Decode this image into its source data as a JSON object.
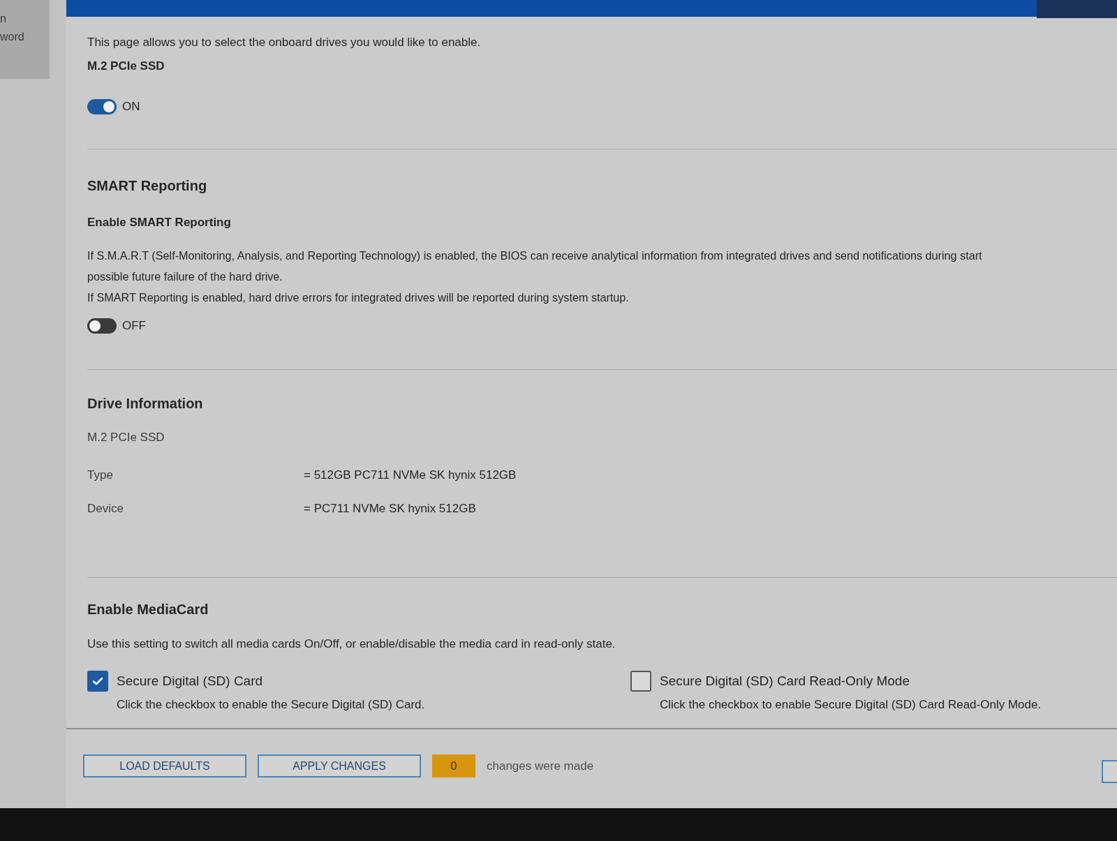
{
  "sidebar": {
    "items": [
      "n",
      "word"
    ]
  },
  "onboard_drives": {
    "description": "This page allows you to select the onboard drives you would like to enable.",
    "setting_label": "M.2 PCIe SSD",
    "on": true,
    "state_label": "ON"
  },
  "smart_reporting": {
    "title": "SMART Reporting",
    "setting_label": "Enable SMART Reporting",
    "description_lines": [
      "If S.M.A.R.T (Self-Monitoring, Analysis, and Reporting Technology) is enabled, the BIOS can receive analytical information from integrated drives and send notifications during start",
      "possible future failure of the hard drive.",
      "If SMART Reporting is enabled, hard drive errors for integrated drives will be reported during system startup."
    ],
    "on": false,
    "state_label": "OFF"
  },
  "drive_information": {
    "title": "Drive Information",
    "drive": "M.2 PCIe SSD",
    "rows": [
      {
        "label": "Type",
        "value": "= 512GB PC711 NVMe SK hynix 512GB"
      },
      {
        "label": "Device",
        "value": "= PC711 NVMe SK hynix 512GB"
      }
    ]
  },
  "media_card": {
    "title": "Enable MediaCard",
    "description": "Use this setting to switch all media cards On/Off, or enable/disable the media card in read-only state.",
    "options": [
      {
        "label": "Secure Digital (SD) Card",
        "description": "Click the checkbox to enable the Secure Digital (SD) Card.",
        "checked": true
      },
      {
        "label": "Secure Digital (SD) Card Read-Only Mode",
        "description": "Click the checkbox to enable Secure Digital (SD) Card Read-Only Mode.",
        "checked": false
      }
    ]
  },
  "footer": {
    "buttons": [
      "LOAD DEFAULTS",
      "APPLY CHANGES"
    ],
    "changes_count": "0",
    "changes_text": "changes were made"
  }
}
